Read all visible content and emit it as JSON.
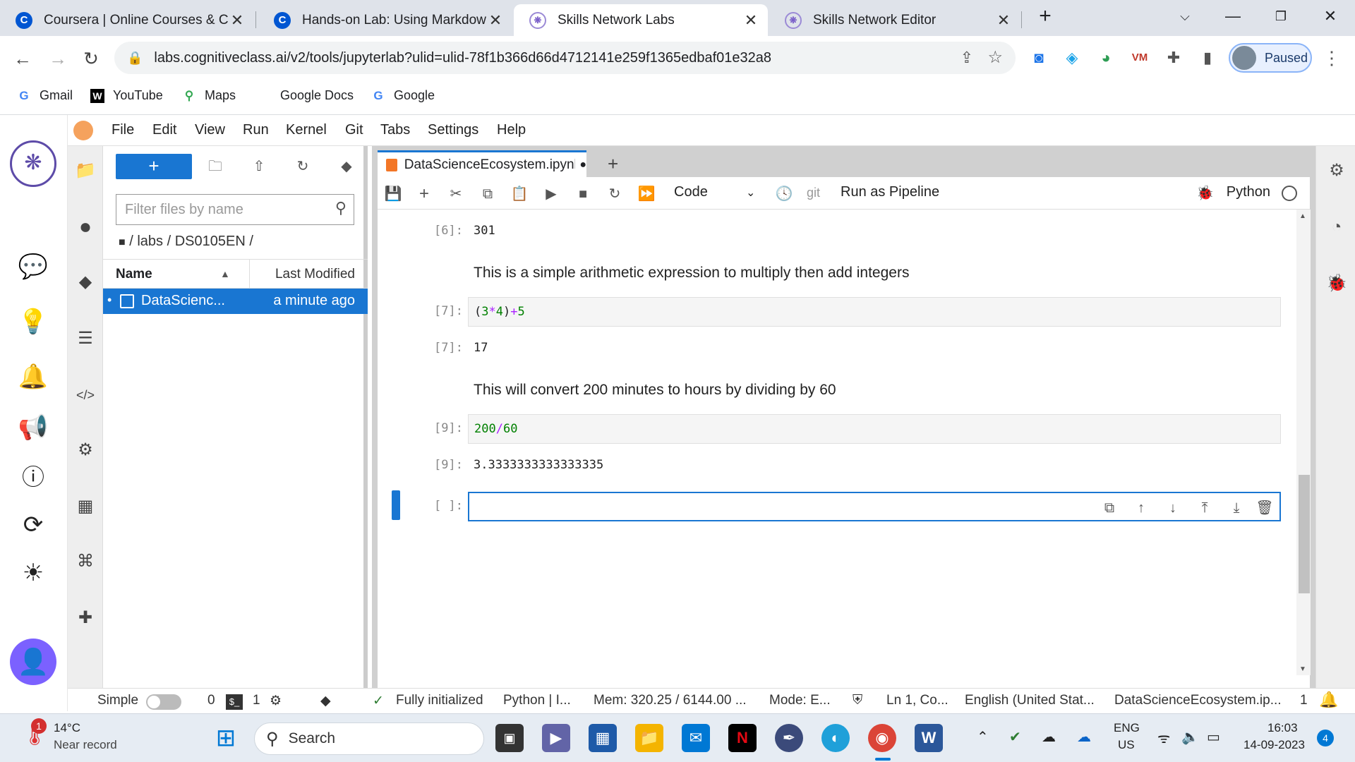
{
  "browser": {
    "tabs": [
      {
        "title": "Coursera | Online Courses & Cre",
        "icon": "coursera-icon",
        "active": false
      },
      {
        "title": "Hands-on Lab: Using Markdown",
        "icon": "coursera-icon",
        "active": false
      },
      {
        "title": "Skills Network Labs",
        "icon": "skills-network-icon",
        "active": true
      },
      {
        "title": "Skills Network Editor",
        "icon": "skills-network-icon",
        "active": false
      }
    ],
    "url": "labs.cognitiveclass.ai/v2/tools/jupyterlab?ulid=ulid-78f1b366d66d4712141e259f1365edbaf01e32a8",
    "profile_status": "Paused",
    "bookmarks": [
      "Gmail",
      "YouTube",
      "Maps",
      "Google Docs",
      "Google"
    ]
  },
  "jupyter": {
    "menu": [
      "File",
      "Edit",
      "View",
      "Run",
      "Kernel",
      "Git",
      "Tabs",
      "Settings",
      "Help"
    ],
    "filebrowser": {
      "filter_placeholder": "Filter files by name",
      "breadcrumb": "/ labs / DS0105EN /",
      "col_name": "Name",
      "col_modified": "Last Modified",
      "file_name": "DataScienc...",
      "file_modified": "a minute ago"
    },
    "doc_tab": "DataScienceEcosystem.ipynb",
    "toolbar": {
      "cell_type": "Code",
      "git_label": "git",
      "pipeline": "Run as Pipeline",
      "kernel": "Python"
    },
    "cells": {
      "out6_prompt": "[6]:",
      "out6": "301",
      "md1": "This is a simple arithmetic expression to multiply then add integers",
      "in7_prompt": "[7]:",
      "out7_prompt": "[7]:",
      "out7": "17",
      "md2": "This will convert 200 minutes to hours by dividing by 60",
      "in9_prompt": "[9]:",
      "out9_prompt": "[9]:",
      "out9": "3.3333333333333335",
      "empty_prompt": "[ ]:"
    },
    "code7": {
      "p1": "(",
      "n1": "3",
      "op1": "*",
      "n2": "4",
      "p2": ")",
      "op2": "+",
      "n3": "5"
    },
    "code9": {
      "n1": "200",
      "op": "/",
      "n2": "60"
    },
    "status": {
      "simple": "Simple",
      "n0": "0",
      "n1": "1",
      "init": "Fully initialized",
      "kernel": "Python | I...",
      "mem": "Mem: 320.25 / 6144.00 ...",
      "mode": "Mode: E...",
      "pos": "Ln 1, Co...",
      "lang": "English (United Stat...",
      "file": "DataScienceEcosystem.ip...",
      "count": "1"
    }
  },
  "taskbar": {
    "weather_temp": "14°C",
    "weather_desc": "Near record",
    "weather_badge": "1",
    "search": "Search",
    "lang": "ENG",
    "region": "US",
    "time": "16:03",
    "date": "14-09-2023",
    "notif_count": "4"
  },
  "colors": {
    "accent": "#1976d2",
    "chrome_strip": "#dfe3ea"
  }
}
